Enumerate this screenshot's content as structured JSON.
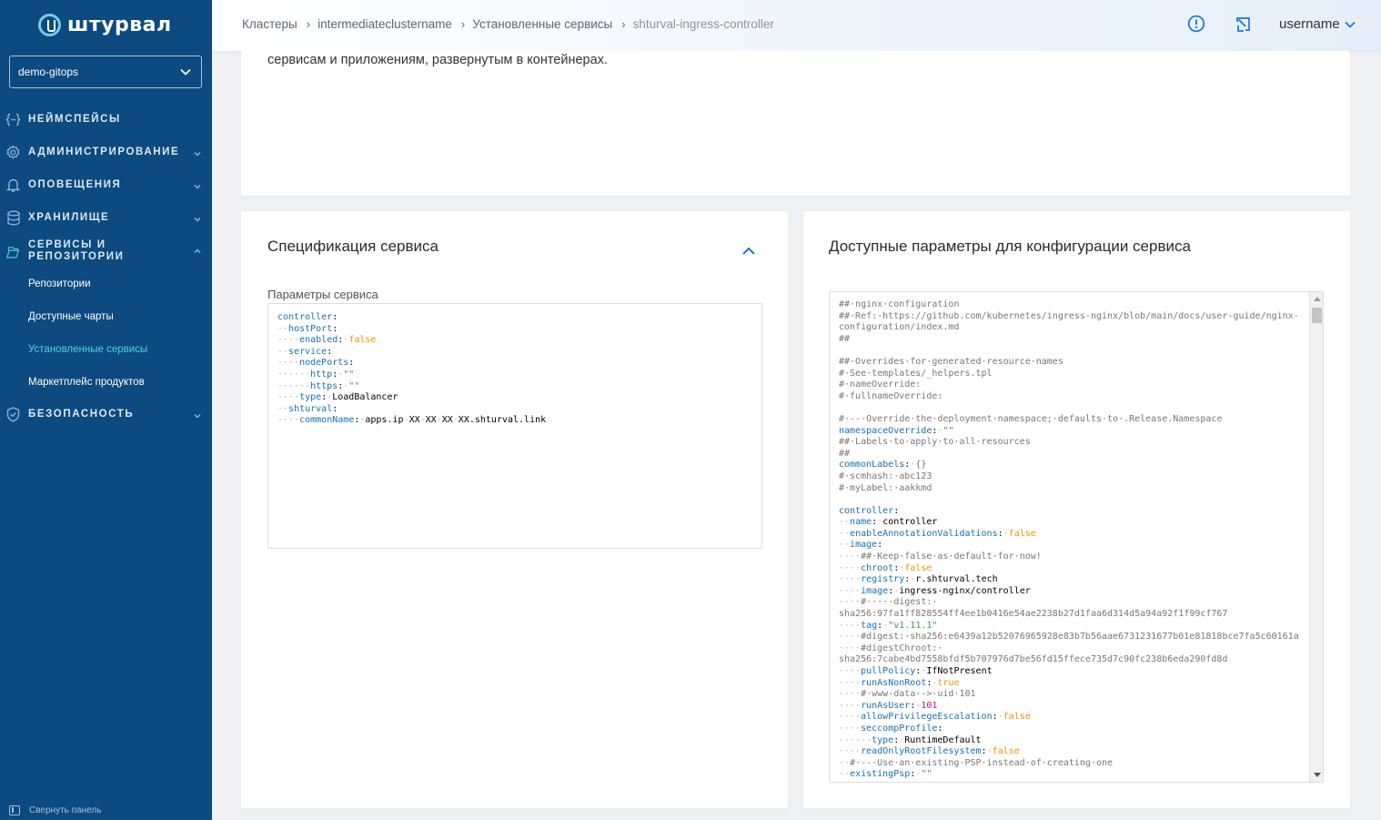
{
  "sidebar": {
    "logo_text": "штурвал",
    "namespace_selector": "demo-gitops",
    "nav": {
      "namespaces": "НЕЙМСПЕЙСЫ",
      "administration": "АДМИНИСТРИРОВАНИЕ",
      "alerts": "ОПОВЕЩЕНИЯ",
      "storage": "ХРАНИЛИЩЕ",
      "services_line1": "СЕРВИСЫ И",
      "services_line2": "РЕПОЗИТОРИИ",
      "security": "БЕЗОПАСНОСТЬ"
    },
    "submenu": [
      "Репозитории",
      "Доступные чарты",
      "Установленные сервисы",
      "Маркетплейс продуктов"
    ],
    "active_submenu": "Установленные сервисы",
    "collapse_label": "Свернуть панель"
  },
  "header": {
    "breadcrumbs": [
      "Кластеры",
      "intermediateclustername",
      "Установленные сервисы",
      "shturval-ingress-controller"
    ],
    "username": "username"
  },
  "top_card": {
    "text": "сервисам и приложениям, развернутым в контейнерах."
  },
  "spec_card": {
    "title": "Спецификация сервиса",
    "params_label": "Параметры сервиса",
    "code": [
      [
        [
          "k",
          "controller"
        ],
        [
          "p",
          ":"
        ]
      ],
      [
        [
          "d",
          "··"
        ],
        [
          "k",
          "hostPort"
        ],
        [
          "p",
          ":"
        ]
      ],
      [
        [
          "d",
          "····"
        ],
        [
          "k",
          "enabled"
        ],
        [
          "p",
          ":"
        ],
        [
          "d",
          "·"
        ],
        [
          "n",
          "false"
        ]
      ],
      [
        [
          "d",
          "··"
        ],
        [
          "k",
          "service"
        ],
        [
          "p",
          ":"
        ]
      ],
      [
        [
          "d",
          "····"
        ],
        [
          "k",
          "nodePorts"
        ],
        [
          "p",
          ":"
        ]
      ],
      [
        [
          "d",
          "······"
        ],
        [
          "k",
          "http"
        ],
        [
          "p",
          ":"
        ],
        [
          "d",
          "·"
        ],
        [
          "s",
          "\"\""
        ]
      ],
      [
        [
          "d",
          "······"
        ],
        [
          "k",
          "https"
        ],
        [
          "p",
          ":"
        ],
        [
          "d",
          "·"
        ],
        [
          "s",
          "\"\""
        ]
      ],
      [
        [
          "d",
          "····"
        ],
        [
          "k",
          "type"
        ],
        [
          "p",
          ":"
        ],
        [
          "d",
          "·"
        ],
        [
          "v",
          "LoadBalancer"
        ]
      ],
      [
        [
          "d",
          "··"
        ],
        [
          "k",
          "shturval"
        ],
        [
          "p",
          ":"
        ]
      ],
      [
        [
          "d",
          "····"
        ],
        [
          "k",
          "commonName"
        ],
        [
          "p",
          ":"
        ],
        [
          "d",
          "·"
        ],
        [
          "v",
          "apps.ip"
        ],
        [
          "d",
          "-"
        ],
        [
          "v",
          "XX"
        ],
        [
          "d",
          "-"
        ],
        [
          "v",
          "XX"
        ],
        [
          "d",
          "-"
        ],
        [
          "v",
          "XX"
        ],
        [
          "d",
          "-"
        ],
        [
          "v",
          "XX.shturval.link"
        ]
      ]
    ]
  },
  "params_card": {
    "title": "Доступные параметры для конфигурации сервиса",
    "code": [
      [
        [
          "m",
          "##·nginx·configuration"
        ]
      ],
      [
        [
          "m",
          "##·Ref:·https://github.com/kubernetes/ingress-nginx/blob/main/docs/user-guide/nginx-"
        ]
      ],
      [
        [
          "m",
          "configuration/index.md"
        ]
      ],
      [
        [
          "m",
          "##"
        ]
      ],
      [],
      [
        [
          "m",
          "##·Overrides·for·generated·resource·names"
        ]
      ],
      [
        [
          "m",
          "#·See·templates/_helpers.tpl"
        ]
      ],
      [
        [
          "m",
          "#·nameOverride:"
        ]
      ],
      [
        [
          "m",
          "#·fullnameOverride:"
        ]
      ],
      [],
      [
        [
          "m",
          "#·--·Override·the·deployment·namespace;·defaults·to·.Release.Namespace"
        ]
      ],
      [
        [
          "k",
          "namespaceOverride"
        ],
        [
          "p",
          ":"
        ],
        [
          "d",
          "·"
        ],
        [
          "s",
          "\"\""
        ]
      ],
      [
        [
          "m",
          "##·Labels·to·apply·to·all·resources"
        ]
      ],
      [
        [
          "m",
          "##"
        ]
      ],
      [
        [
          "k",
          "commonLabels"
        ],
        [
          "p",
          ":"
        ],
        [
          "d",
          "·"
        ],
        [
          "m",
          "{}"
        ]
      ],
      [
        [
          "m",
          "#·scmhash:·abc123"
        ]
      ],
      [
        [
          "m",
          "#·myLabel:·aakkmd"
        ]
      ],
      [],
      [
        [
          "k",
          "controller"
        ],
        [
          "p",
          ":"
        ]
      ],
      [
        [
          "d",
          "··"
        ],
        [
          "k",
          "name"
        ],
        [
          "p",
          ":"
        ],
        [
          "d",
          "·"
        ],
        [
          "v",
          "controller"
        ]
      ],
      [
        [
          "d",
          "··"
        ],
        [
          "k",
          "enableAnnotationValidations"
        ],
        [
          "p",
          ":"
        ],
        [
          "d",
          "·"
        ],
        [
          "n",
          "false"
        ]
      ],
      [
        [
          "d",
          "··"
        ],
        [
          "k",
          "image"
        ],
        [
          "p",
          ":"
        ]
      ],
      [
        [
          "d",
          "····"
        ],
        [
          "m",
          "##·Keep·false·as·default·for·now!"
        ]
      ],
      [
        [
          "d",
          "····"
        ],
        [
          "k",
          "chroot"
        ],
        [
          "p",
          ":"
        ],
        [
          "d",
          "·"
        ],
        [
          "n",
          "false"
        ]
      ],
      [
        [
          "d",
          "····"
        ],
        [
          "k",
          "registry"
        ],
        [
          "p",
          ":"
        ],
        [
          "d",
          "·"
        ],
        [
          "v",
          "r.shturval.tech"
        ]
      ],
      [
        [
          "d",
          "····"
        ],
        [
          "k",
          "image"
        ],
        [
          "p",
          ":"
        ],
        [
          "d",
          "·"
        ],
        [
          "v",
          "ingress-nginx/controller"
        ]
      ],
      [
        [
          "d",
          "····"
        ],
        [
          "m",
          "#·····digest:·"
        ]
      ],
      [
        [
          "m",
          "sha256:97fa1ff828554ff4ee1b0416e54ae2238b27d1faa6d314d5a94a92f1f99cf767"
        ]
      ],
      [
        [
          "d",
          "····"
        ],
        [
          "k",
          "tag"
        ],
        [
          "p",
          ":"
        ],
        [
          "d",
          "·"
        ],
        [
          "s",
          "\"v1.11.1\""
        ]
      ],
      [
        [
          "d",
          "····"
        ],
        [
          "m",
          "#digest:·sha256:e6439a12b52076965928e83b7b56aae6731231677b01e81818bce7fa5c60161a"
        ]
      ],
      [
        [
          "d",
          "····"
        ],
        [
          "m",
          "#digestChroot:·"
        ]
      ],
      [
        [
          "m",
          "sha256:7cabe4bd7558bfdf5b707976d7be56fd15ffece735d7c90fc238b6eda290fd8d"
        ]
      ],
      [
        [
          "d",
          "····"
        ],
        [
          "k",
          "pullPolicy"
        ],
        [
          "p",
          ":"
        ],
        [
          "d",
          "·"
        ],
        [
          "v",
          "IfNotPresent"
        ]
      ],
      [
        [
          "d",
          "····"
        ],
        [
          "k",
          "runAsNonRoot"
        ],
        [
          "p",
          ":"
        ],
        [
          "d",
          "·"
        ],
        [
          "n",
          "true"
        ]
      ],
      [
        [
          "d",
          "····"
        ],
        [
          "m",
          "#·www-data·->·uid·101"
        ]
      ],
      [
        [
          "d",
          "····"
        ],
        [
          "k",
          "runAsUser"
        ],
        [
          "p",
          ":"
        ],
        [
          "d",
          "·"
        ],
        [
          "num",
          "101"
        ]
      ],
      [
        [
          "d",
          "····"
        ],
        [
          "k",
          "allowPrivilegeEscalation"
        ],
        [
          "p",
          ":"
        ],
        [
          "d",
          "·"
        ],
        [
          "n",
          "false"
        ]
      ],
      [
        [
          "d",
          "····"
        ],
        [
          "k",
          "seccompProfile"
        ],
        [
          "p",
          ":"
        ]
      ],
      [
        [
          "d",
          "······"
        ],
        [
          "k",
          "type"
        ],
        [
          "p",
          ":"
        ],
        [
          "d",
          "·"
        ],
        [
          "v",
          "RuntimeDefault"
        ]
      ],
      [
        [
          "d",
          "····"
        ],
        [
          "k",
          "readOnlyRootFilesystem"
        ],
        [
          "p",
          ":"
        ],
        [
          "d",
          "·"
        ],
        [
          "n",
          "false"
        ]
      ],
      [
        [
          "d",
          "··"
        ],
        [
          "m",
          "#·--·Use·an·existing·PSP·instead·of·creating·one"
        ]
      ],
      [
        [
          "d",
          "··"
        ],
        [
          "k",
          "existingPsp"
        ],
        [
          "p",
          ":"
        ],
        [
          "d",
          "·"
        ],
        [
          "s",
          "\"\""
        ]
      ]
    ]
  },
  "colors": {
    "sidebar_bg": "#0c4a80",
    "active_item": "#4ed4d8",
    "accent": "#1a73e8",
    "yaml_key": "#1a6fb5",
    "yaml_bool": "#f39200",
    "yaml_string": "#3aa33e",
    "yaml_comment": "#777777",
    "yaml_number": "#b0178c"
  },
  "icons": [
    "logo-icon",
    "chevron-down-icon",
    "braces-icon",
    "gear-icon",
    "bell-icon",
    "database-icon",
    "services-icon",
    "shield-icon",
    "chevron-up-icon",
    "alert-circle-icon",
    "external-window-icon",
    "panel-collapse-icon"
  ]
}
